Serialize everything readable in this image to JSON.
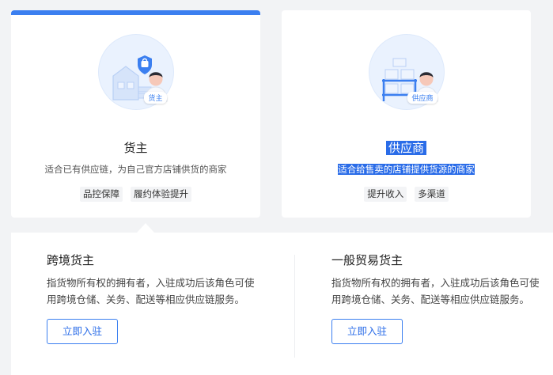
{
  "cards": [
    {
      "title": "货主",
      "desc": "适合已有供应链，为自己官方店铺供货的商家",
      "role_tag": "货主",
      "tags": [
        "品控保障",
        "履约体验提升"
      ],
      "active": true,
      "icon": "shopping-bag-shield-icon"
    },
    {
      "title": "供应商",
      "desc": "适合给售卖的店铺提供货源的商家",
      "role_tag": "供应商",
      "tags": [
        "提升收入",
        "多渠道"
      ],
      "text_selected": true,
      "icon": "shelves-icon"
    }
  ],
  "options": [
    {
      "title": "跨境货主",
      "desc": "指货物所有权的拥有者，入驻成功后该角色可使用跨境仓储、关务、配送等相应供应链服务。",
      "button": "立即入驻"
    },
    {
      "title": "一般贸易货主",
      "desc": "指货物所有权的拥有者，入驻成功后该角色可使用跨境仓储、关务、配送等相应供应链服务。",
      "button": "立即入驻"
    }
  ],
  "colors": {
    "accent": "#3b7ff0",
    "selection": "#2a6ce8",
    "page_bg": "#f2f3f5"
  }
}
